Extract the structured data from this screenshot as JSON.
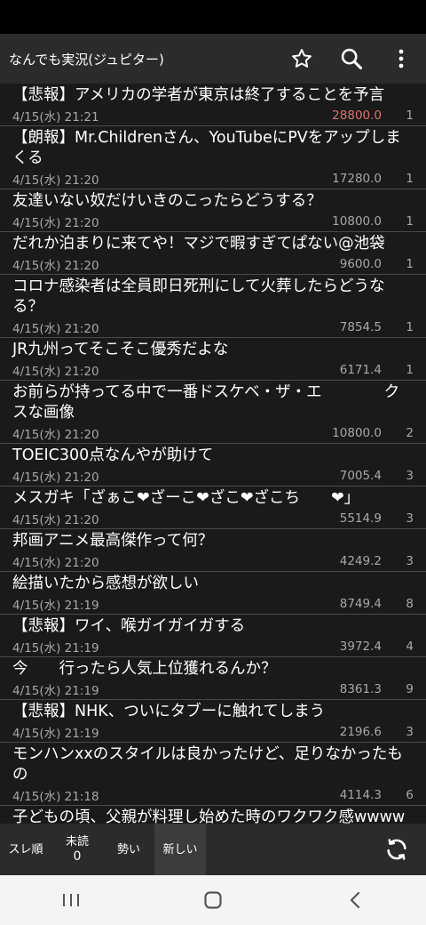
{
  "appbar": {
    "title": "なんでも実況(ジュピター)",
    "icons": [
      "star-icon",
      "search-icon",
      "more-vert-icon"
    ]
  },
  "threads": [
    {
      "title": "【悲報】アメリカの学者が東京は終了することを予言",
      "date": "4/15(水) 21:21",
      "score": "28800.0",
      "count": "1",
      "hot": true
    },
    {
      "title": "【朗報】Mr.Childrenさん、YouTubeにPVをアップしまくる",
      "date": "4/15(水) 21:20",
      "score": "17280.0",
      "count": "1",
      "hot": false
    },
    {
      "title": "友達いない奴だけいきのこったらどうする？",
      "date": "4/15(水) 21:20",
      "score": "10800.0",
      "count": "1",
      "hot": false
    },
    {
      "title": "だれか泊まりに来てや！マジで暇すぎてぱない@池袋",
      "date": "4/15(水) 21:20",
      "score": "9600.0",
      "count": "1",
      "hot": false
    },
    {
      "title": "コロナ感染者は全員即日死刑にして火葬したらどうなる？",
      "date": "4/15(水) 21:20",
      "score": "7854.5",
      "count": "1",
      "hot": false
    },
    {
      "title": "JR九州ってそこそこ優秀だよな",
      "date": "4/15(水) 21:20",
      "score": "6171.4",
      "count": "1",
      "hot": false
    },
    {
      "title": "お前らが持ってる中で一番ドスケベ・ザ・エ　　　　クスな画像",
      "date": "4/15(水) 21:20",
      "score": "10800.0",
      "count": "2",
      "hot": false
    },
    {
      "title": "TOEIC300点なんやが助けて",
      "date": "4/15(水) 21:20",
      "score": "7005.4",
      "count": "3",
      "hot": false
    },
    {
      "title": "メスガキ「ざぁこ❤ざーこ❤ざこ❤ざこち　　❤」",
      "date": "4/15(水) 21:20",
      "score": "5514.9",
      "count": "3",
      "hot": false
    },
    {
      "title": "邦画アニメ最高傑作って何？",
      "date": "4/15(水) 21:20",
      "score": "4249.2",
      "count": "3",
      "hot": false
    },
    {
      "title": "絵描いたから感想が欲しい",
      "date": "4/15(水) 21:19",
      "score": "8749.4",
      "count": "8",
      "hot": false
    },
    {
      "title": "【悲報】ワイ、喉ガイガイガする",
      "date": "4/15(水) 21:19",
      "score": "3972.4",
      "count": "4",
      "hot": false
    },
    {
      "title": "今　　行ったら人気上位獲れるんか？",
      "date": "4/15(水) 21:19",
      "score": "8361.3",
      "count": "9",
      "hot": false
    },
    {
      "title": "【悲報】NHK、ついにタブーに触れてしまう",
      "date": "4/15(水) 21:19",
      "score": "2196.6",
      "count": "3",
      "hot": false
    },
    {
      "title": "モンハンxxのスタイルは良かったけど、足りなかったもの",
      "date": "4/15(水) 21:18",
      "score": "4114.3",
      "count": "6",
      "hot": false
    },
    {
      "title": "子どもの頃、父親が料理し始めた時のワクワク感wwwwwwwwww",
      "date": "",
      "score": "",
      "count": "",
      "hot": false
    }
  ],
  "tabs": [
    {
      "label": "スレ順",
      "sub": "",
      "active": false
    },
    {
      "label": "未読",
      "sub": "0",
      "active": false
    },
    {
      "label": "勢い",
      "sub": "",
      "active": false
    },
    {
      "label": "新しい",
      "sub": "",
      "active": true
    }
  ],
  "colors": {
    "hot_score": "#e07070",
    "appbar": "#2b2b2b",
    "list_bg": "#1a1a1a"
  }
}
